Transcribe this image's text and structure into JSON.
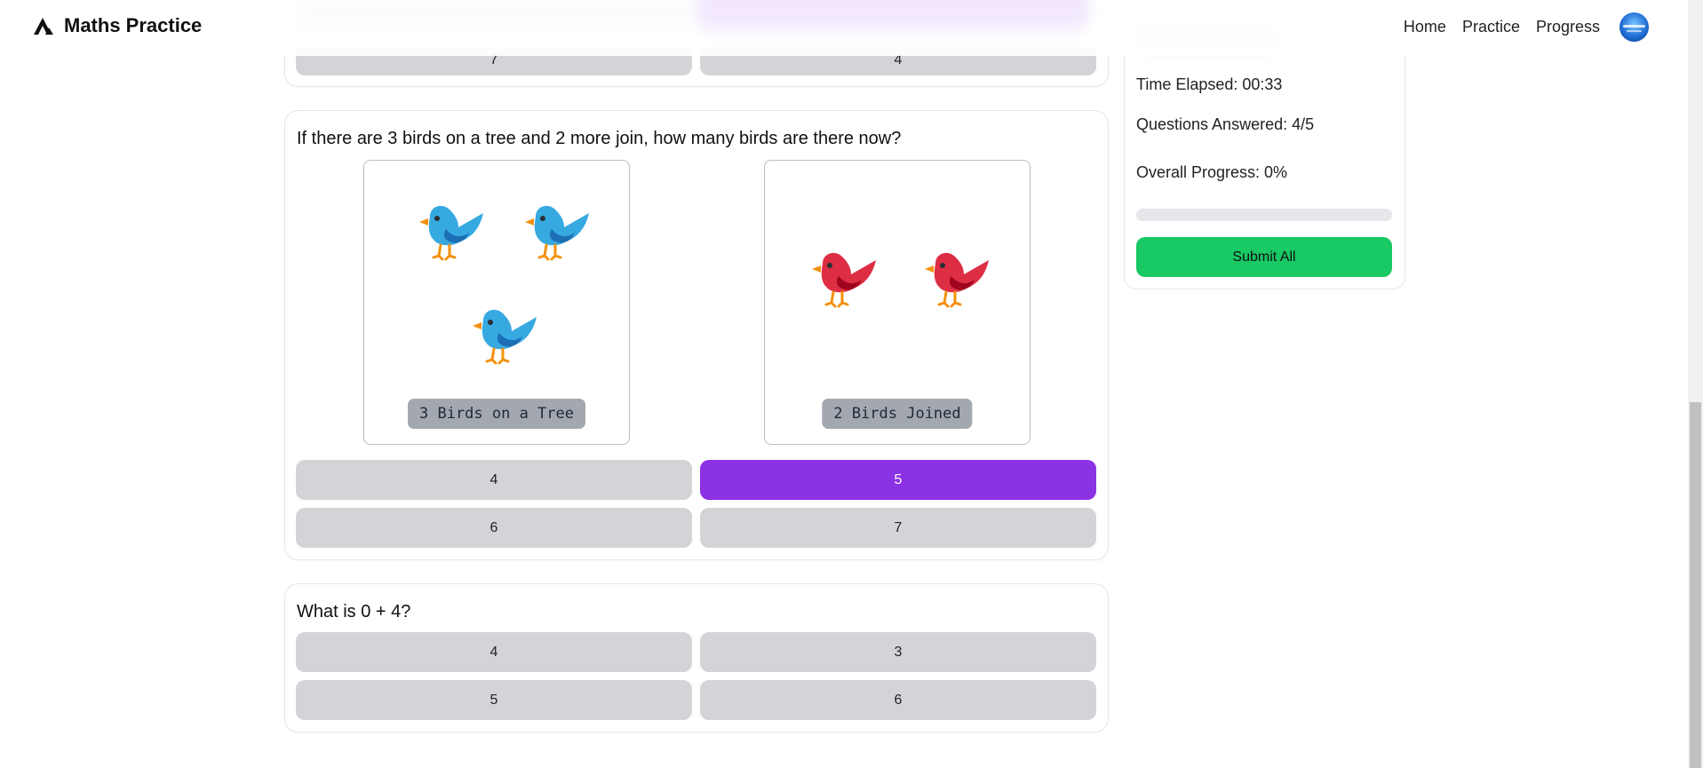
{
  "app": {
    "title": "Maths Practice"
  },
  "nav": {
    "items": [
      "Home",
      "Practice",
      "Progress"
    ]
  },
  "top_card": {
    "options": [
      "7",
      "4"
    ]
  },
  "question_birds": {
    "text": "If there are 3 birds on a tree and 2 more join, how many birds are there now?",
    "pictures": [
      {
        "label": "3 Birds on a Tree",
        "icon": "blue-bird-icon",
        "count": 3,
        "color": "#36a9e1"
      },
      {
        "label": "2 Birds Joined",
        "icon": "red-bird-icon",
        "count": 2,
        "color": "#dd2e44"
      }
    ],
    "options": [
      "4",
      "5",
      "6",
      "7"
    ],
    "selected": "5"
  },
  "question_add": {
    "text": "What is 0 + 4?",
    "options": [
      "4",
      "3",
      "5",
      "6"
    ]
  },
  "sidebar": {
    "time_elapsed": "Time Elapsed: 00:33",
    "questions_answered": "Questions Answered: 4/5",
    "overall_progress": "Overall Progress: 0%",
    "progress_value": 0,
    "submit_label": "Submit All"
  },
  "colors": {
    "accent": "#8b32e5",
    "submit": "#18c964",
    "option_bg": "#d4d4d8"
  }
}
